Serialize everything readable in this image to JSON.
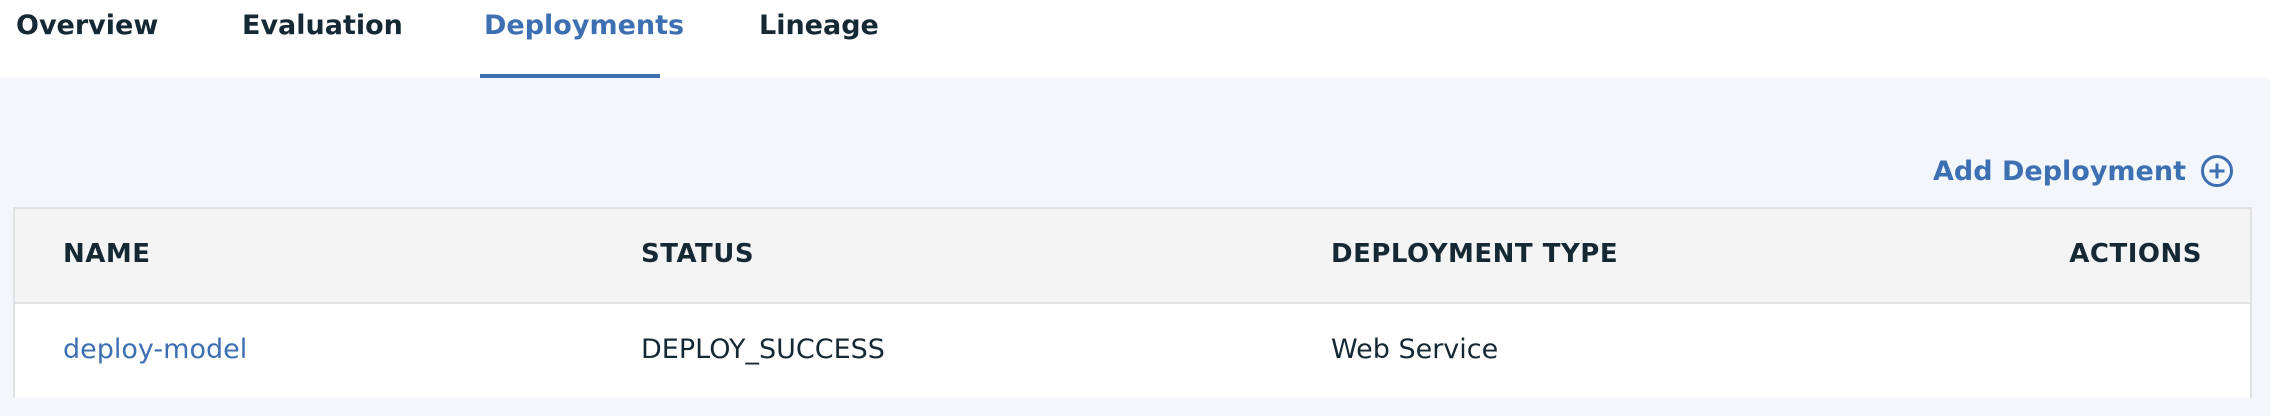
{
  "tabs": [
    {
      "label": "Overview",
      "active": false
    },
    {
      "label": "Evaluation",
      "active": false
    },
    {
      "label": "Deployments",
      "active": true
    },
    {
      "label": "Lineage",
      "active": false
    }
  ],
  "toolbar": {
    "add_label": "Add Deployment",
    "add_icon": "plus-circle-icon"
  },
  "table": {
    "columns": [
      "NAME",
      "STATUS",
      "DEPLOYMENT TYPE",
      "ACTIONS"
    ],
    "rows": [
      {
        "name": "deploy-model",
        "status": "DEPLOY_SUCCESS",
        "type": "Web Service",
        "actions": ""
      }
    ]
  },
  "colors": {
    "accent": "#3d70b2",
    "text": "#152935",
    "background": "#f3f6fa",
    "header_bg": "#f4f4f4",
    "border": "#dfe3e6"
  }
}
